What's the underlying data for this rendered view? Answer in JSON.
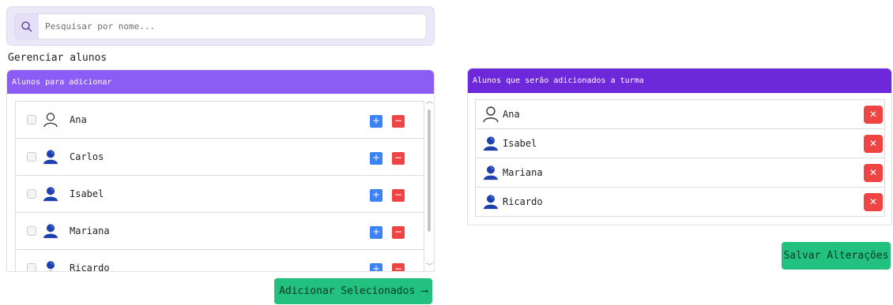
{
  "search": {
    "placeholder": "Pesquisar por nome...",
    "icon": "search-icon"
  },
  "manage": {
    "title": "Gerenciar alunos"
  },
  "available": {
    "header": "Alunos para adicionar",
    "students": [
      {
        "name": "Ana",
        "avatar": "person-outline-icon"
      },
      {
        "name": "Carlos",
        "avatar": "person-filled-icon"
      },
      {
        "name": "Isabel",
        "avatar": "person-filled-icon"
      },
      {
        "name": "Mariana",
        "avatar": "person-filled-icon"
      },
      {
        "name": "Ricardo",
        "avatar": "person-filled-icon"
      }
    ],
    "add_symbol": "+",
    "remove_symbol": "−"
  },
  "add_selected_label": "Adicionar Selecionados ⟶",
  "selected": {
    "header": "Alunos que serão adicionados a turma",
    "students": [
      {
        "name": "Ana",
        "avatar": "person-outline-icon"
      },
      {
        "name": "Isabel",
        "avatar": "person-filled-icon"
      },
      {
        "name": "Mariana",
        "avatar": "person-filled-icon"
      },
      {
        "name": "Ricardo",
        "avatar": "person-filled-icon"
      }
    ],
    "remove_symbol": "✕"
  },
  "save_label": "Salvar Alterações",
  "colors": {
    "left_header": "#8b5cf6",
    "right_header": "#6d28d9",
    "add_button": "#3b82f6",
    "remove_button": "#ef4444",
    "action_button": "#22c17f",
    "avatar_blue": "#1e40af"
  }
}
